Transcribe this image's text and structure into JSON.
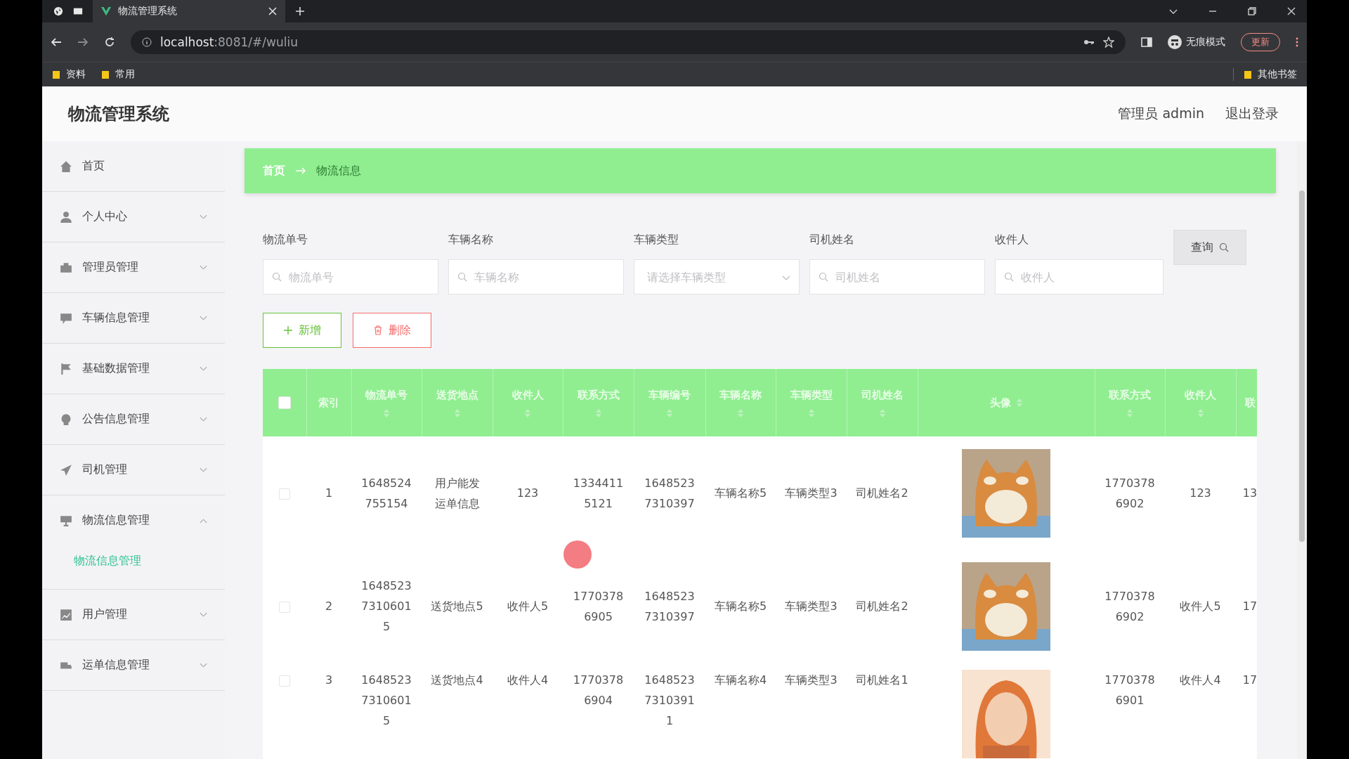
{
  "browser": {
    "tab_title": "物流管理系统",
    "url_host": "localhost",
    "url_rest": ":8081/#/wuliu",
    "incognito_label": "无痕模式",
    "update_button": "更新",
    "bookmarks": [
      "资料",
      "常用"
    ],
    "other_bookmarks": "其他书签"
  },
  "header": {
    "title": "物流管理系统",
    "user": "管理员 admin",
    "logout": "退出登录"
  },
  "sidebar": [
    {
      "label": "首页",
      "kind": "link"
    },
    {
      "label": "个人中心",
      "kind": "submenu",
      "expanded": false
    },
    {
      "label": "管理员管理",
      "kind": "submenu",
      "expanded": false
    },
    {
      "label": "车辆信息管理",
      "kind": "submenu",
      "expanded": false
    },
    {
      "label": "基础数据管理",
      "kind": "submenu",
      "expanded": false
    },
    {
      "label": "公告信息管理",
      "kind": "submenu",
      "expanded": false
    },
    {
      "label": "司机管理",
      "kind": "submenu",
      "expanded": false
    },
    {
      "label": "物流信息管理",
      "kind": "submenu",
      "expanded": true,
      "children": [
        {
          "label": "物流信息管理",
          "selected": true
        }
      ]
    },
    {
      "label": "用户管理",
      "kind": "submenu",
      "expanded": false
    },
    {
      "label": "运单信息管理",
      "kind": "submenu",
      "expanded": false
    }
  ],
  "breadcrumb": [
    "首页",
    "物流信息"
  ],
  "filters": [
    {
      "label": "物流单号",
      "placeholder": "物流单号",
      "kind": "text"
    },
    {
      "label": "车辆名称",
      "placeholder": "车辆名称",
      "kind": "text"
    },
    {
      "label": "车辆类型",
      "placeholder": "请选择车辆类型",
      "kind": "select"
    },
    {
      "label": "司机姓名",
      "placeholder": "司机姓名",
      "kind": "text"
    },
    {
      "label": "收件人",
      "placeholder": "收件人",
      "kind": "text"
    }
  ],
  "search_button": "查询",
  "actions": [
    {
      "label": "新增",
      "kind": "add"
    },
    {
      "label": "删除",
      "kind": "delete"
    }
  ],
  "table": {
    "select_all_checked": false,
    "columns": [
      {
        "label": "索引",
        "sortable": false
      },
      {
        "label": "物流单号",
        "sortable": true
      },
      {
        "label": "送货地点",
        "sortable": true
      },
      {
        "label": "收件人",
        "sortable": true
      },
      {
        "label": "联系方式",
        "sortable": true
      },
      {
        "label": "车辆编号",
        "sortable": true
      },
      {
        "label": "车辆名称",
        "sortable": true
      },
      {
        "label": "车辆类型",
        "sortable": true
      },
      {
        "label": "司机姓名",
        "sortable": true
      },
      {
        "label": "头像",
        "sortable": true,
        "kind": "picture"
      },
      {
        "label": "联系方式",
        "sortable": true
      },
      {
        "label": "收件人",
        "sortable": true
      },
      {
        "label": "联",
        "sortable": false
      }
    ],
    "rows": [
      {
        "checked": false,
        "cells": [
          "1",
          "1648524755154",
          "用户能发运单信息",
          "123",
          "13344115121",
          "16485237310397",
          "车辆名称5",
          "车辆类型3",
          "司机姓名2",
          {
            "kind": "picture"
          },
          "17703786902",
          "123",
          "13"
        ]
      },
      {
        "checked": false,
        "cells": [
          "2",
          "164852373106015",
          "送货地点5",
          "收件人5",
          "17703786905",
          "16485237310397",
          "车辆名称5",
          "车辆类型3",
          "司机姓名2",
          {
            "kind": "picture"
          },
          "17703786902",
          "收件人5",
          "17"
        ]
      },
      {
        "checked": false,
        "cells": [
          "3",
          "164852373106015",
          "送货地点4",
          "收件人4",
          "17703786904",
          "164852373103911",
          "车辆名称4",
          "车辆类型3",
          "司机姓名1",
          {
            "kind": "picture"
          },
          "17703786901",
          "收件人4",
          "17"
        ]
      }
    ]
  }
}
